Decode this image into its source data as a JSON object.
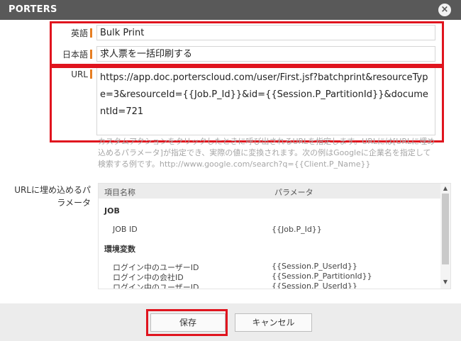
{
  "titlebar": {
    "title": "PORTERS",
    "close_glyph": "×"
  },
  "form": {
    "english_label": "英語",
    "english_value": "Bulk Print",
    "japanese_label": "日本語",
    "japanese_value": "求人票を一括印刷する",
    "url_label": "URL",
    "url_value": "https://app.doc.porterscloud.com/user/First.jsf?batchprint&resourceType=3&resourceId={{Job.P_Id}}&id={{Session.P_PartitionId}}&documentId=721",
    "help_text": "カスタムアクションをクリックしたときに呼び出されるURLを指定します。URLには[URLに埋め込めるパラメータ]が指定でき、実際の値に変換されます。次の例はGoogleに企業名を指定して検索する例です。http://www.google.com/search?q={{Client.P_Name}}"
  },
  "params": {
    "label": "URLに埋め込めるパラメータ",
    "col_name": "項目名称",
    "col_param": "パラメータ",
    "groups": [
      {
        "title": "JOB",
        "rows": [
          {
            "name": "JOB ID",
            "param": "{{Job.P_Id}}"
          }
        ]
      },
      {
        "title": "環境変数",
        "rows": [
          {
            "name": "ログイン中のユーザーID",
            "param": "{{Session.P_UserId}}"
          },
          {
            "name": "ログイン中の会社ID",
            "param": "{{Session.P_PartitionId}}"
          },
          {
            "name": "ログイン中のユーザーID",
            "param": "{{Session.P_UserId}}"
          }
        ]
      }
    ],
    "scroll_up_glyph": "▲",
    "scroll_down_glyph": "▼"
  },
  "footer": {
    "save_label": "保存",
    "cancel_label": "キャンセル"
  },
  "colors": {
    "highlight": "#e0141e",
    "label_bar": "#e67e22",
    "titlebar": "#595959"
  }
}
